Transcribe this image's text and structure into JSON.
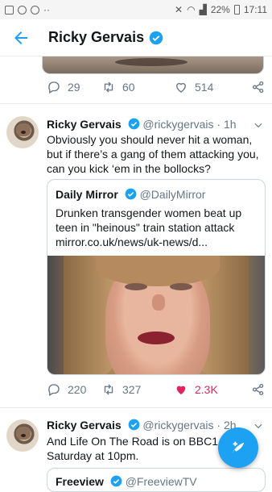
{
  "status_bar": {
    "battery": "22%",
    "time": "17:11"
  },
  "header": {
    "title": "Ricky Gervais"
  },
  "top_tweet": {
    "replies": "29",
    "retweets": "60",
    "likes": "514"
  },
  "tweet1": {
    "name": "Ricky Gervais",
    "handle": "@rickygervais",
    "dot": "·",
    "time": "1h",
    "text": "Obviously you should never hit a woman, but if there’s a gang of them attacking you, can you kick ‘em in the bollocks?",
    "quote": {
      "name": "Daily Mirror",
      "handle": "@DailyMirror",
      "text": "Drunken transgender women beat up teen in \"heinous\" train station attack mirror.co.uk/news/uk-news/d..."
    },
    "replies": "220",
    "retweets": "327",
    "likes": "2.3K",
    "liked_color": "#e0245e"
  },
  "tweet2": {
    "name": "Ricky Gervais",
    "handle": "@rickygervais",
    "dot": "·",
    "time": "2h",
    "text": "And Life On The Road is on BBC1 next Saturday at 10pm.",
    "quote": {
      "name": "Freeview",
      "handle": "@FreeviewTV"
    }
  },
  "accent_color": "#1da1f2",
  "icons": [
    "back-arrow-icon",
    "verified-icon",
    "reply-icon",
    "retweet-icon",
    "heart-icon",
    "share-icon",
    "chevron-down-icon",
    "compose-icon"
  ]
}
